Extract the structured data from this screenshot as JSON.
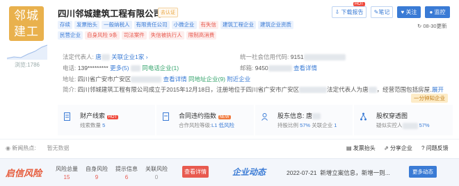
{
  "company": {
    "logo_text": "邻城建工",
    "views": "浏览:1786",
    "name": "四川邻城建筑工程有限公司",
    "auth_badge": "去认证"
  },
  "tags_row1": [
    {
      "label": "存续",
      "tone": "blue"
    },
    {
      "label": "发票抬头",
      "tone": "blue"
    },
    {
      "label": "一般纳税人",
      "tone": "blue"
    },
    {
      "label": "有限责任公司",
      "tone": "blue"
    },
    {
      "label": "小微企业",
      "tone": "blue"
    },
    {
      "label": "有失信",
      "tone": "red"
    },
    {
      "label": "建筑工程企业",
      "tone": "blue"
    },
    {
      "label": "建筑企业资质",
      "tone": "blue"
    }
  ],
  "tags_row2": [
    {
      "label": "民营企业",
      "tone": "blue"
    },
    {
      "label": "自身风险 9条",
      "tone": "red"
    },
    {
      "label": "司法案件",
      "tone": "red"
    },
    {
      "label": "失信被执行人",
      "tone": "red"
    },
    {
      "label": "限制高消费",
      "tone": "red"
    }
  ],
  "actions": {
    "hot": "HOT",
    "download": "下载报告",
    "note": "笔记",
    "follow": "关注",
    "monitor": "监控"
  },
  "updated": "08-30更新",
  "info": {
    "legal_rep_label": "法定代表人:",
    "legal_rep_name": "唐",
    "related_companies": "关联企业1家",
    "credit_code_label": "统一社会信用代码:",
    "credit_code": "9151",
    "phone_label": "电话:",
    "phone": "139*********",
    "phone_more": "更多(5)",
    "same_phone": "同电话企业(1)",
    "email_label": "邮箱:",
    "email": "9450",
    "email_detail": "查看详情",
    "address_label": "地址:",
    "address": "四川省广安市广安区",
    "address_detail": "查看详情",
    "same_address": "同地址企业(9)",
    "nearby": "附近企业",
    "intro_label": "简介:",
    "intro": "四川邻城建筑工程有限公司成立于2015年12月18日，注册地位于四川省广安市广安区",
    "intro_tail": "法定代表人为唐",
    "intro_tail2": "，经营范围包括房屋...",
    "expand": "展开",
    "chain_button": "一分钟知企业"
  },
  "cards": [
    {
      "title": "财产线索",
      "badge": "HOT",
      "sub_label": "线索数量",
      "sub_value": "5"
    },
    {
      "title": "合同违约指数",
      "badge": "NEW",
      "sub_label": "合作风险等级:",
      "sub_value": "L1 低风险"
    },
    {
      "title": "股东信息: 唐",
      "badge": "",
      "sub_label": "持股比例",
      "sub_value": "57%",
      "sub_label2": "关联企业",
      "sub_value2": "1"
    },
    {
      "title": "股权穿透图",
      "badge": "",
      "sub_label": "疑似实控人",
      "sub_value": "57%"
    }
  ],
  "news": {
    "label": "新闻热点:",
    "value": "暂无数据",
    "invoice": "发票抬头",
    "share": "分享企业",
    "feedback": "问题反馈"
  },
  "risk": {
    "brand": "启信风险",
    "stats": [
      {
        "label": "风险总量",
        "value": "15"
      },
      {
        "label": "自身风险",
        "value": "9"
      },
      {
        "label": "提示信息",
        "value": "6"
      },
      {
        "label": "关联风险",
        "value": "0"
      }
    ],
    "check": "查看详情"
  },
  "dynamics": {
    "brand": "企业动态",
    "date": "2022-07-21",
    "text": "新增立案信息，新增一则...",
    "more": "更多动态"
  }
}
